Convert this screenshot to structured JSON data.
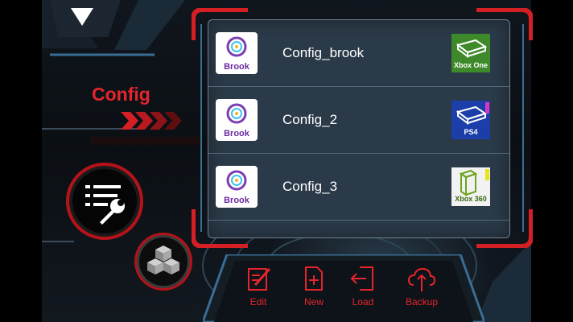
{
  "section_title": "Config",
  "configs": [
    {
      "name": "Config_brook",
      "logo_text": "Brook",
      "console": "Xbox One",
      "console_color": "#3e8a2b"
    },
    {
      "name": "Config_2",
      "logo_text": "Brook",
      "console": "PS4",
      "console_color": "#1b3ea8"
    },
    {
      "name": "Config_3",
      "logo_text": "Brook",
      "console": "Xbox 360",
      "console_color": "#f2f2f2"
    }
  ],
  "toolbar": {
    "edit_label": "Edit",
    "new_label": "New",
    "load_label": "Load",
    "backup_label": "Backup"
  },
  "colors": {
    "accent": "#e5252b",
    "panel": "#2b3a48",
    "frame_blue": "#3a6d94"
  },
  "icons": {
    "dropdown": "triangle-down-icon",
    "settings": "list-wrench-icon",
    "modules": "cubes-icon"
  }
}
